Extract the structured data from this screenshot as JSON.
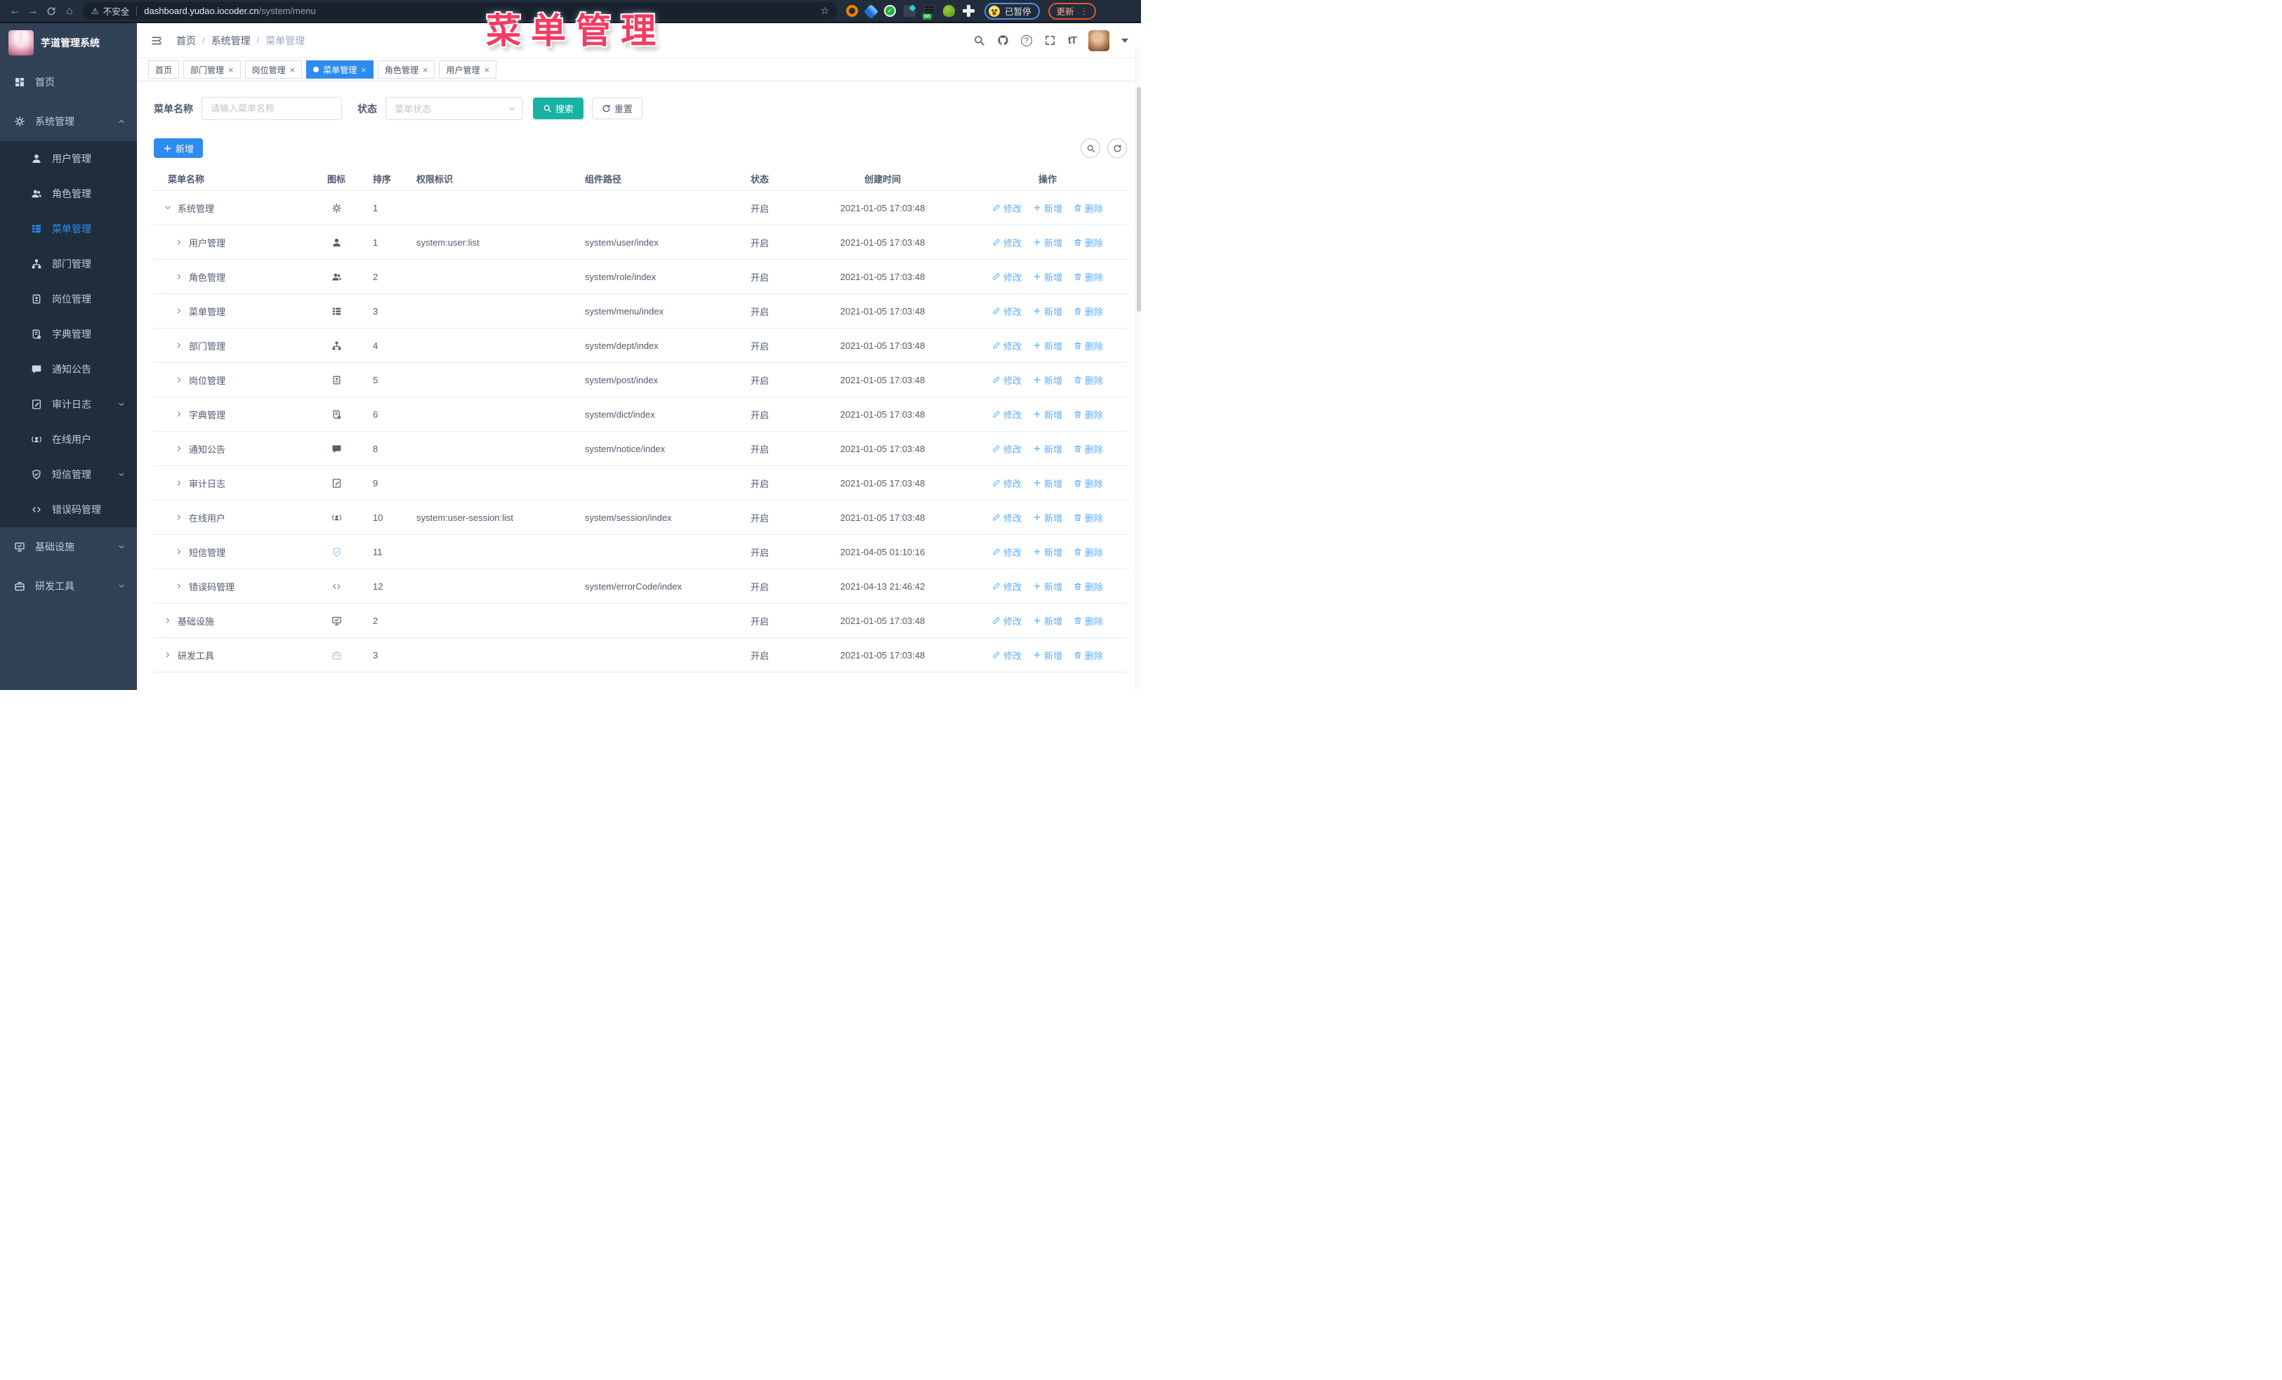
{
  "browser": {
    "security_label": "不安全",
    "url_host": "dashboard.yudao.iocoder.cn",
    "url_path": "/system/menu",
    "extension_on_badge": "on",
    "paused_badge": "已暂停",
    "update_button": "更新"
  },
  "annotation": {
    "title": "菜单管理"
  },
  "sidebar": {
    "logo_title": "芋道管理系统",
    "items": [
      {
        "label": "首页",
        "icon": "dashboard",
        "type": "top"
      },
      {
        "label": "系统管理",
        "icon": "gear",
        "type": "top",
        "arrow": "up"
      },
      {
        "label": "用户管理",
        "icon": "user",
        "type": "sub"
      },
      {
        "label": "角色管理",
        "icon": "users",
        "type": "sub"
      },
      {
        "label": "菜单管理",
        "icon": "menu-table",
        "type": "sub",
        "active": true
      },
      {
        "label": "部门管理",
        "icon": "tree",
        "type": "sub"
      },
      {
        "label": "岗位管理",
        "icon": "badge",
        "type": "sub"
      },
      {
        "label": "字典管理",
        "icon": "dict",
        "type": "sub"
      },
      {
        "label": "通知公告",
        "icon": "message",
        "type": "sub"
      },
      {
        "label": "审计日志",
        "icon": "log",
        "type": "sub",
        "arrow": "down"
      },
      {
        "label": "在线用户",
        "icon": "online",
        "type": "sub"
      },
      {
        "label": "短信管理",
        "icon": "shield",
        "type": "sub",
        "arrow": "down"
      },
      {
        "label": "错误码管理",
        "icon": "code",
        "type": "sub"
      },
      {
        "label": "基础设施",
        "icon": "monitor",
        "type": "top",
        "arrow": "down"
      },
      {
        "label": "研发工具",
        "icon": "toolbox",
        "type": "top",
        "arrow": "down"
      }
    ]
  },
  "header": {
    "breadcrumb": [
      "首页",
      "系统管理",
      "菜单管理"
    ],
    "font_size_icon_text": "tT"
  },
  "tabs": [
    {
      "label": "首页"
    },
    {
      "label": "部门管理",
      "closable": true
    },
    {
      "label": "岗位管理",
      "closable": true
    },
    {
      "label": "菜单管理",
      "closable": true,
      "active": true
    },
    {
      "label": "角色管理",
      "closable": true
    },
    {
      "label": "用户管理",
      "closable": true
    }
  ],
  "search": {
    "name_label": "菜单名称",
    "name_placeholder": "请输入菜单名称",
    "status_label": "状态",
    "status_placeholder": "菜单状态",
    "search_button": "搜索",
    "reset_button": "重置"
  },
  "toolbar": {
    "add_button": "新增"
  },
  "table": {
    "columns": [
      "菜单名称",
      "图标",
      "排序",
      "权限标识",
      "组件路径",
      "状态",
      "创建时间",
      "操作"
    ],
    "action_labels": {
      "edit": "修改",
      "add": "新增",
      "delete": "删除"
    },
    "rows": [
      {
        "name": "系统管理",
        "level": 0,
        "expand": "down",
        "icon": "gear",
        "sort": "1",
        "perm": "",
        "path": "",
        "status": "开启",
        "time": "2021-01-05 17:03:48"
      },
      {
        "name": "用户管理",
        "level": 1,
        "expand": "right",
        "icon": "user",
        "sort": "1",
        "perm": "system:user:list",
        "path": "system/user/index",
        "status": "开启",
        "time": "2021-01-05 17:03:48"
      },
      {
        "name": "角色管理",
        "level": 1,
        "expand": "right",
        "icon": "users",
        "sort": "2",
        "perm": "",
        "path": "system/role/index",
        "status": "开启",
        "time": "2021-01-05 17:03:48"
      },
      {
        "name": "菜单管理",
        "level": 1,
        "expand": "right",
        "icon": "menu-table",
        "sort": "3",
        "perm": "",
        "path": "system/menu/index",
        "status": "开启",
        "time": "2021-01-05 17:03:48"
      },
      {
        "name": "部门管理",
        "level": 1,
        "expand": "right",
        "icon": "tree",
        "sort": "4",
        "perm": "",
        "path": "system/dept/index",
        "status": "开启",
        "time": "2021-01-05 17:03:48"
      },
      {
        "name": "岗位管理",
        "level": 1,
        "expand": "right",
        "icon": "badge",
        "sort": "5",
        "perm": "",
        "path": "system/post/index",
        "status": "开启",
        "time": "2021-01-05 17:03:48"
      },
      {
        "name": "字典管理",
        "level": 1,
        "expand": "right",
        "icon": "dict",
        "sort": "6",
        "perm": "",
        "path": "system/dict/index",
        "status": "开启",
        "time": "2021-01-05 17:03:48"
      },
      {
        "name": "通知公告",
        "level": 1,
        "expand": "right",
        "icon": "message",
        "sort": "8",
        "perm": "",
        "path": "system/notice/index",
        "status": "开启",
        "time": "2021-01-05 17:03:48"
      },
      {
        "name": "审计日志",
        "level": 1,
        "expand": "right",
        "icon": "log",
        "sort": "9",
        "perm": "",
        "path": "",
        "status": "开启",
        "time": "2021-01-05 17:03:48"
      },
      {
        "name": "在线用户",
        "level": 1,
        "expand": "right",
        "icon": "online",
        "sort": "10",
        "perm": "system:user-session:list",
        "path": "system/session/index",
        "status": "开启",
        "time": "2021-01-05 17:03:48"
      },
      {
        "name": "短信管理",
        "level": 1,
        "expand": "right",
        "icon": "shield",
        "sort": "11",
        "perm": "",
        "path": "",
        "status": "开启",
        "time": "2021-04-05 01:10:16"
      },
      {
        "name": "错误码管理",
        "level": 1,
        "expand": "right",
        "icon": "code",
        "sort": "12",
        "perm": "",
        "path": "system/errorCode/index",
        "status": "开启",
        "time": "2021-04-13 21:46:42"
      },
      {
        "name": "基础设施",
        "level": 0,
        "expand": "right",
        "icon": "monitor",
        "sort": "2",
        "perm": "",
        "path": "",
        "status": "开启",
        "time": "2021-01-05 17:03:48"
      },
      {
        "name": "研发工具",
        "level": 0,
        "expand": "right",
        "icon": "toolbox",
        "sort": "3",
        "perm": "",
        "path": "",
        "status": "开启",
        "time": "2021-01-05 17:03:48"
      }
    ]
  }
}
